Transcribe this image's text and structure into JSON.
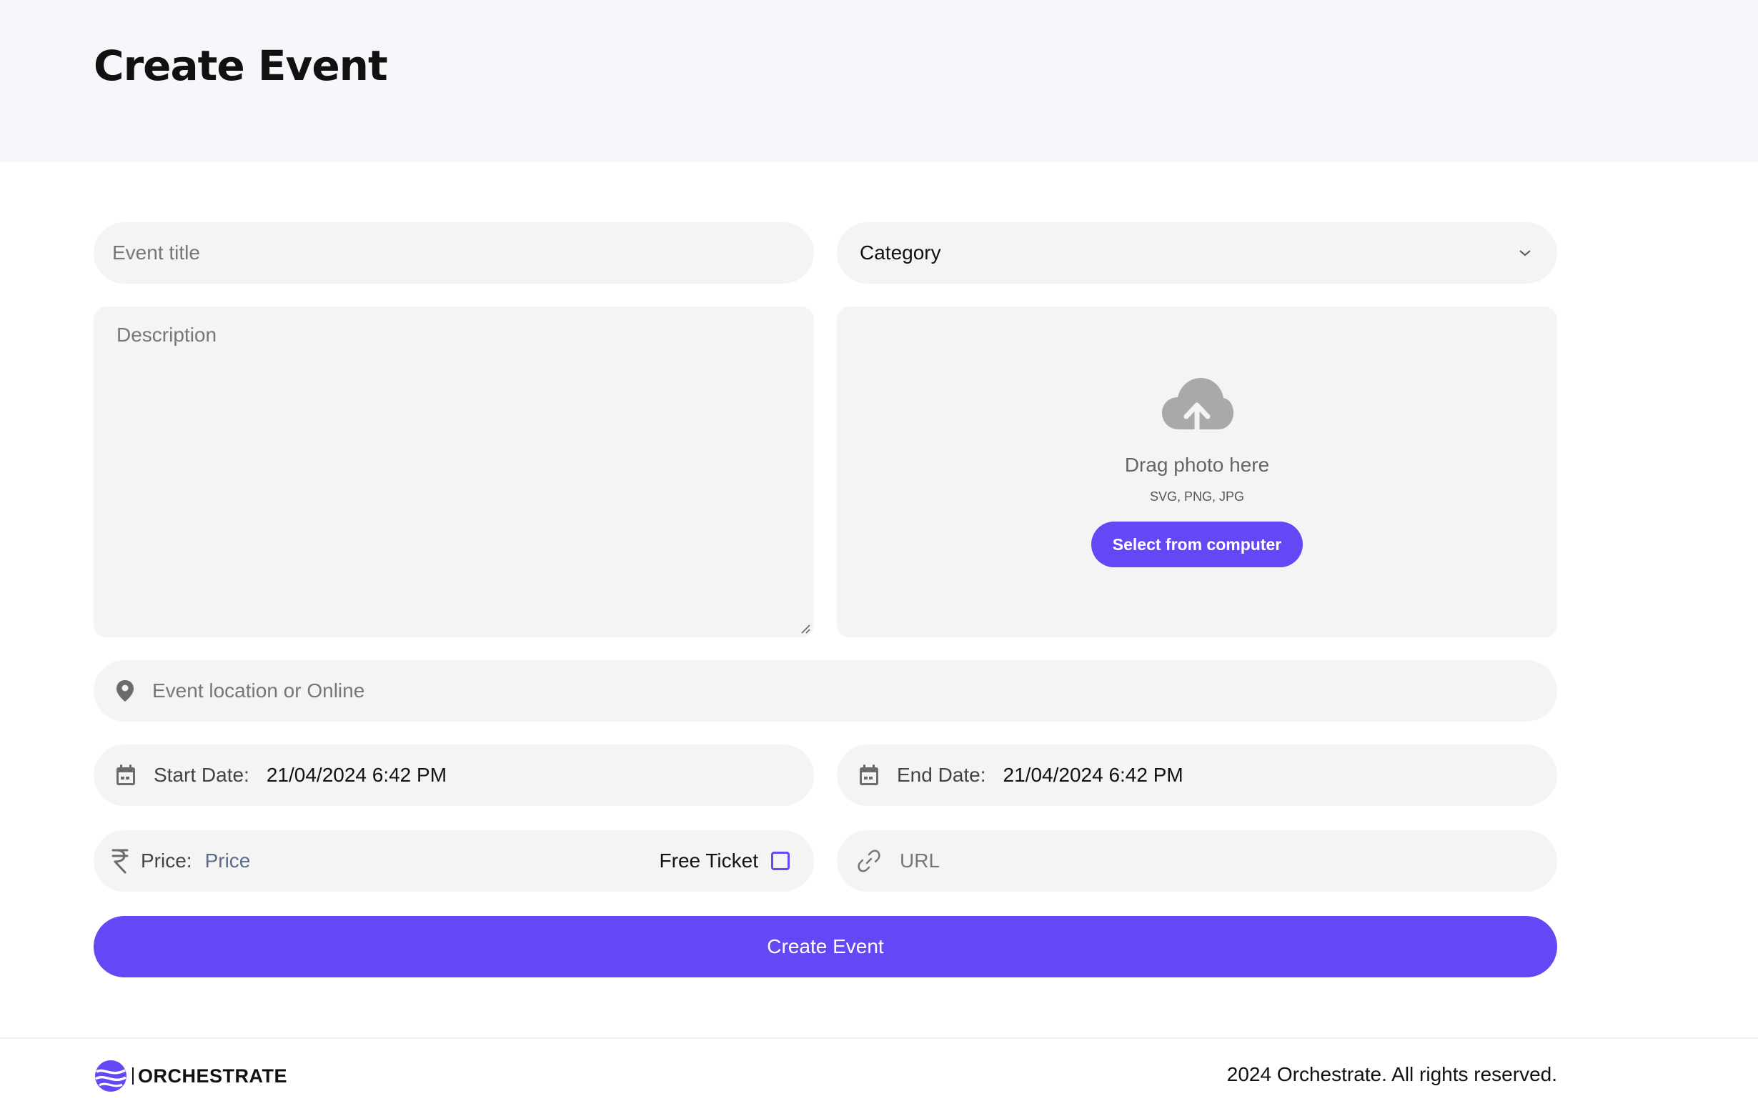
{
  "page": {
    "title": "Create Event"
  },
  "form": {
    "title_placeholder": "Event title",
    "category_selected": "Category",
    "description_placeholder": "Description",
    "upload": {
      "heading": "Drag photo here",
      "formats": "SVG, PNG, JPG",
      "button_label": "Select from computer"
    },
    "location_placeholder": "Event location or Online",
    "start_date": {
      "label": "Start Date:",
      "value": "21/04/2024 6:42 PM"
    },
    "end_date": {
      "label": "End Date:",
      "value": "21/04/2024 6:42 PM"
    },
    "price": {
      "label": "Price:",
      "placeholder": "Price"
    },
    "free_ticket": {
      "label": "Free Ticket",
      "checked": false
    },
    "url_placeholder": "URL",
    "submit_label": "Create Event"
  },
  "footer": {
    "brand": "ORCHESTRATE",
    "copyright": "2024 Orchestrate. All rights reserved."
  },
  "colors": {
    "accent": "#6249f5",
    "field_bg": "#f4f4f4",
    "hero_bg": "#f6f7fb"
  },
  "icons": {
    "category": "chevron-down-icon",
    "upload": "cloud-upload-icon",
    "location": "map-pin-icon",
    "date": "calendar-icon",
    "price": "rupee-icon",
    "url": "link-icon",
    "brand": "orchestrate-logo"
  }
}
